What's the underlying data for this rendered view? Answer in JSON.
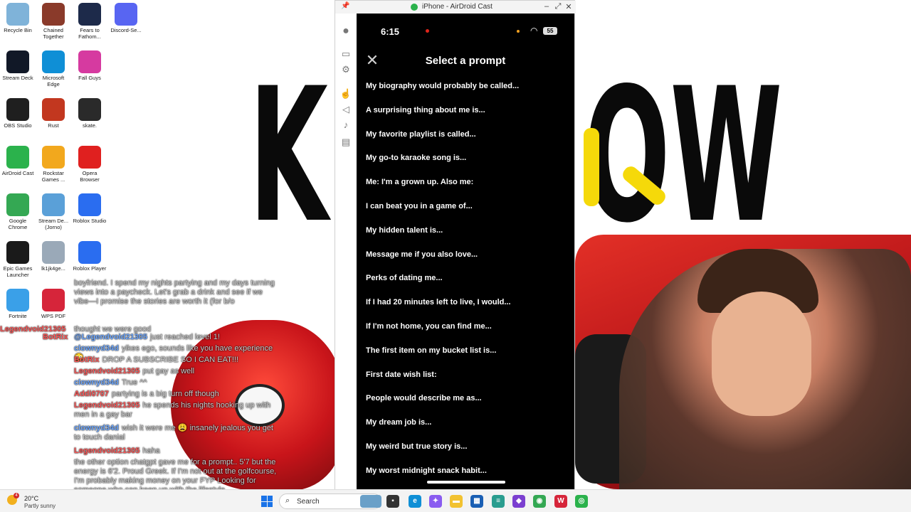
{
  "airdroid_window": {
    "title": "iPhone - AirDroid Cast",
    "controls": [
      "–",
      "⤢",
      "✕"
    ]
  },
  "phone": {
    "status_time": "6:15",
    "battery": "55",
    "screen_title": "Select a prompt",
    "prompts": [
      "My biography would probably be called...",
      "A surprising thing about me is...",
      "My favorite playlist is called...",
      "My go-to karaoke song is...",
      "Me: I'm a grown up. Also me:",
      "I can beat you in a game of...",
      "My hidden talent is...",
      "Message me if you also love...",
      "Perks of dating me...",
      "If I had 20 minutes left to live, I would...",
      "If I'm not home, you can find me...",
      "The first item on my bucket list is...",
      "First date wish list:",
      "People would describe me as...",
      "My dream job is...",
      "My weird but true story is...",
      "My worst midnight snack habit..."
    ]
  },
  "desktop_icons": [
    {
      "label": "Recycle Bin",
      "icon": "recycle-bin-icon",
      "color": "#7fb3d9"
    },
    {
      "label": "Chained Together",
      "icon": "game-icon",
      "color": "#8a3a2a"
    },
    {
      "label": "Fears to Fathom...",
      "icon": "game-icon",
      "color": "#1d2a4a"
    },
    {
      "label": "Discord-Se...",
      "icon": "discord-icon",
      "color": "#5865f2"
    },
    {
      "label": "Stream Deck",
      "icon": "stream-deck-icon",
      "color": "#111827"
    },
    {
      "label": "Microsoft Edge",
      "icon": "edge-icon",
      "color": "#0f8fd6"
    },
    {
      "label": "Fall Guys",
      "icon": "game-icon",
      "color": "#d63aa0"
    },
    {
      "label": "OBS Studio",
      "icon": "obs-icon",
      "color": "#1f1f1f"
    },
    {
      "label": "Rust",
      "icon": "game-icon",
      "color": "#c2371f"
    },
    {
      "label": "skate.",
      "icon": "game-icon",
      "color": "#2a2a2a"
    },
    {
      "label": "AirDroid Cast",
      "icon": "airdroid-icon",
      "color": "#2bb24c"
    },
    {
      "label": "Rockstar Games ...",
      "icon": "rockstar-icon",
      "color": "#f2a81d"
    },
    {
      "label": "Opera Browser",
      "icon": "opera-icon",
      "color": "#e0201f"
    },
    {
      "label": "Google Chrome",
      "icon": "chrome-icon",
      "color": "#34a853"
    },
    {
      "label": "Stream De... (Jorno)",
      "icon": "shortcut-icon",
      "color": "#5aa0d8"
    },
    {
      "label": "Roblox Studio",
      "icon": "roblox-icon",
      "color": "#2a6df0"
    },
    {
      "label": "Epic Games Launcher",
      "icon": "epic-icon",
      "color": "#1a1a1a"
    },
    {
      "label": "lk1jk4ge...",
      "icon": "file-icon",
      "color": "#9aa9b8"
    },
    {
      "label": "Roblox Player",
      "icon": "roblox-icon",
      "color": "#2a6df0"
    },
    {
      "label": "Fortnite",
      "icon": "game-icon",
      "color": "#3aa0e8"
    },
    {
      "label": "WPS PDF",
      "icon": "pdf-icon",
      "color": "#d6253a"
    }
  ],
  "chat": [
    {
      "user": "",
      "text": "boyfriend. I spend my nights partying and my days turning views into a paycheck. Let's grab a drink and see if we vibe—I promise the stories are worth it (for b/o"
    },
    {
      "user": "",
      "text": "thought we were good"
    },
    {
      "user": "Legendvoid21305",
      "text": ""
    },
    {
      "user": "@Legendvoid21305",
      "text": "just reached level 1!"
    },
    {
      "user": "BotRix",
      "text": ""
    },
    {
      "user": "clownyd34d",
      "text": "yikes ego, sounds like you have experience 😳"
    },
    {
      "user": "BotRix",
      "text": "DROP A SUBSCRIBE SO I CAN EAT!!!"
    },
    {
      "user": "Legendvoid21305",
      "text": "put gay as well"
    },
    {
      "user": "clownyd34d",
      "text": "True ^^"
    },
    {
      "user": "Addi0707",
      "text": "partying is a big turn off though"
    },
    {
      "user": "Legendvoid21305",
      "text": "he spends his nights hooking up with men in a gay bar"
    },
    {
      "user": "clownyd34d",
      "text": "wish it were me 😩 insanely jealous you get to touch danial"
    },
    {
      "user": "Legendvoid21305",
      "text": "haha"
    },
    {
      "user": "",
      "text": "the other option chatgpt gave me for a prompt.. 5'7 but the energy is 6'2. Proud Greek. If I'm not out at the golfcourse, I'm probably making money on your FYP Looking for someone who can keep up with the lifestyle."
    }
  ],
  "taskbar": {
    "weather_temp": "20°C",
    "weather_cond": "Partly sunny",
    "weather_badge": "4",
    "search_label": "Search"
  },
  "colors": {
    "phone_bg": "#000000",
    "accent_green": "#2bb24c",
    "record_red": "#e0251b",
    "username_green": "#6ddc6d",
    "username_blue": "#6fa8ff",
    "username_red": "#ff5a5a"
  }
}
